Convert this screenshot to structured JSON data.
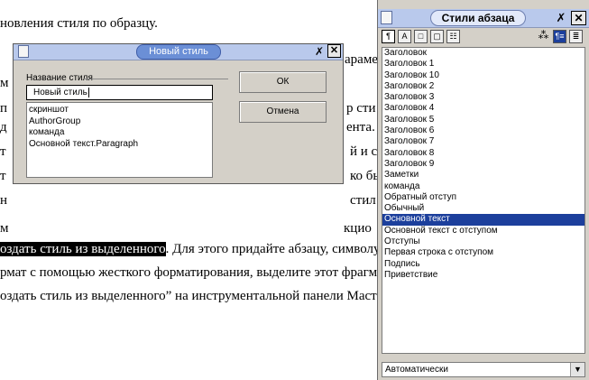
{
  "document": {
    "lines": [
      "новления стиля по образцу.",
      "оздать стиль из выделенного",
      ". Для этого придайте абзацу, символу",
      "рмат с помощью жесткого форматирования, выделите этот фрагме",
      "оздать стиль из выделенного” на инструментальной панели Мастер"
    ],
    "fragments": {
      "l1": "араме",
      "l2": "м",
      "l3": "п",
      "l3r": "р сти",
      "l4": "д",
      "l4r": "ента.",
      "l5": "т",
      "l5r": "й и с",
      "l6": "т",
      "l6r": "ко бы",
      "l7": "н",
      "l7r": "стил",
      "l8": "м",
      "l8r": "кцио"
    }
  },
  "styles_panel": {
    "title": "Стили абзаца",
    "pin_glyph": "✗",
    "close_glyph": "✕",
    "toolbar": {
      "fill_glyph": "⁂",
      "btn1": "¶",
      "btn2": "A",
      "btn3": "□",
      "btn4": "▢",
      "btn5": "☷",
      "btn6": "¶≡",
      "btn7": "≣"
    },
    "items": [
      "Заголовок",
      "Заголовок 1",
      "Заголовок 10",
      "Заголовок 2",
      "Заголовок 3",
      "Заголовок 4",
      "Заголовок 5",
      "Заголовок 6",
      "Заголовок 7",
      "Заголовок 8",
      "Заголовок 9",
      "Заметки",
      "команда",
      "Обратный отступ",
      "Обычный",
      "Основной текст",
      "Основной текст с отступом",
      "Отступы",
      "Первая строка с отступом",
      "Подпись",
      "Приветствие"
    ],
    "selected_item": "Основной текст",
    "filter_value": "Автоматически",
    "filter_arrow": "▼"
  },
  "new_style_dialog": {
    "title": "Новый стиль",
    "pin_glyph": "✗",
    "close_glyph": "✕",
    "group_label": "Название стиля",
    "name_value": "Новый стиль",
    "existing_styles": [
      "скриншот",
      "AuthorGroup",
      "команда",
      "Основной текст.Paragraph"
    ],
    "ok_label": "ОК",
    "cancel_label": "Отмена"
  }
}
